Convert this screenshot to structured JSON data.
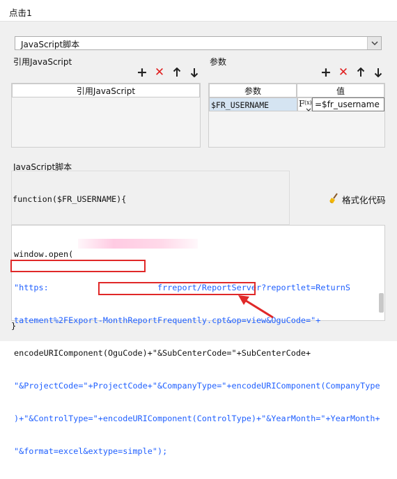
{
  "window": {
    "title": "点击1"
  },
  "script_type": {
    "selected": "JavaScript脚本"
  },
  "refs": {
    "label": "引用JavaScript",
    "column_header": "引用JavaScript"
  },
  "params": {
    "label": "参数",
    "columns": [
      "参数",
      "值"
    ],
    "rows": [
      {
        "name": "$FR_USERNAME",
        "fx": "F(x)",
        "value": "=$fr_username"
      }
    ]
  },
  "script": {
    "label": "JavaScript脚本",
    "function_header": "function($FR_USERNAME){",
    "format_button": "格式化代码",
    "closing": "}",
    "lines": [
      "window.open(",
      "\"https:                      frreport/ReportServer?reportlet=ReturnS",
      "tatement%2FExport-MonthReportFrequently.cpt&op=view&OguCode=\"+",
      "encodeURIComponent(OguCode)+\"&SubCenterCode=\"+SubCenterCode+",
      "\"&ProjectCode=\"+ProjectCode+\"&CompanyType=\"+encodeURIComponent(CompanyType",
      ")+\"&ControlType=\"+encodeURIComponent(ControlType)+\"&YearMonth=\"+YearMonth+",
      "\"&format=excel&extype=simple\");"
    ]
  },
  "icons": {
    "add": "plus-icon",
    "delete": "cross-icon",
    "up": "arrow-up-icon",
    "down": "arrow-down-icon",
    "broom": "broom-icon",
    "dropdown": "chevron-down-icon"
  },
  "colors": {
    "highlight_box": "#e02828",
    "string": "#2060ff",
    "selected_cell": "#d5e4f2"
  }
}
